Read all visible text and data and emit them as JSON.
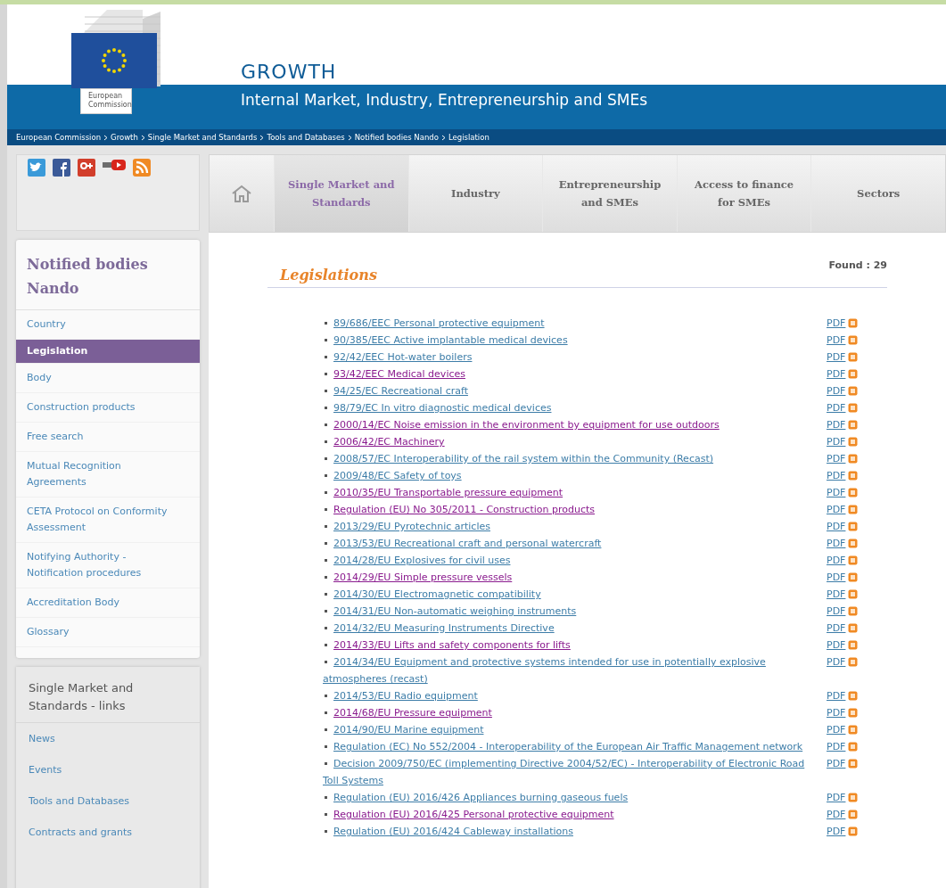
{
  "header": {
    "logo_caption": "European Commission",
    "site_title": "GROWTH",
    "subtitle": "Internal Market, Industry, Entrepreneurship and SMEs"
  },
  "breadcrumb": [
    "European Commission",
    "Growth",
    "Single Market and Standards",
    "Tools and Databases",
    "Notified bodies Nando",
    "Legislation"
  ],
  "social": [
    {
      "kind": "twitter"
    },
    {
      "kind": "facebook"
    },
    {
      "kind": "googleplus"
    },
    {
      "kind": "youtube"
    },
    {
      "kind": "rss"
    }
  ],
  "top_nav": [
    {
      "label": "Single Market and Standards",
      "selected": true
    },
    {
      "label": "Industry",
      "selected": false
    },
    {
      "label": "Entrepreneurship and SMEs",
      "selected": false
    },
    {
      "label": "Access to finance for SMEs",
      "selected": false
    },
    {
      "label": "Sectors",
      "selected": false
    }
  ],
  "sidebar": {
    "title": "Notified bodies Nando",
    "items": [
      {
        "label": "Country",
        "selected": false
      },
      {
        "label": "Legislation",
        "selected": true
      },
      {
        "label": "Body",
        "selected": false
      },
      {
        "label": "Construction products",
        "selected": false
      },
      {
        "label": "Free search",
        "selected": false
      },
      {
        "label": "Mutual Recognition Agreements",
        "selected": false
      },
      {
        "label": "CETA Protocol on Conformity Assessment",
        "selected": false
      },
      {
        "label": "Notifying Authority - Notification procedures",
        "selected": false
      },
      {
        "label": "Accreditation Body",
        "selected": false
      },
      {
        "label": "Glossary",
        "selected": false
      }
    ]
  },
  "links_box": {
    "title": "Single Market and Standards - links",
    "items": [
      "News",
      "Events",
      "Tools and Databases",
      "Contracts and grants"
    ]
  },
  "content": {
    "title": "Legislations",
    "found": "Found : 29",
    "items": [
      {
        "text": "89/686/EEC Personal protective equipment",
        "visited": false,
        "pdf": "PDF"
      },
      {
        "text": "90/385/EEC Active implantable medical devices",
        "visited": false,
        "pdf": "PDF"
      },
      {
        "text": "92/42/EEC Hot-water boilers",
        "visited": false,
        "pdf": "PDF"
      },
      {
        "text": "93/42/EEC Medical devices",
        "visited": true,
        "pdf": "PDF"
      },
      {
        "text": "94/25/EC Recreational craft",
        "visited": false,
        "pdf": "PDF"
      },
      {
        "text": "98/79/EC In vitro diagnostic medical devices",
        "visited": false,
        "pdf": "PDF"
      },
      {
        "text": "2000/14/EC Noise emission in the environment by equipment for use outdoors",
        "visited": true,
        "pdf": "PDF"
      },
      {
        "text": "2006/42/EC Machinery",
        "visited": true,
        "pdf": "PDF"
      },
      {
        "text": "2008/57/EC Interoperability of the rail system within the Community (Recast)",
        "visited": false,
        "pdf": "PDF"
      },
      {
        "text": "2009/48/EC Safety of toys",
        "visited": false,
        "pdf": "PDF"
      },
      {
        "text": "2010/35/EU Transportable pressure equipment",
        "visited": true,
        "pdf": "PDF"
      },
      {
        "text": "Regulation (EU) No 305/2011 - Construction products",
        "visited": true,
        "pdf": "PDF"
      },
      {
        "text": "2013/29/EU Pyrotechnic articles",
        "visited": false,
        "pdf": "PDF"
      },
      {
        "text": "2013/53/EU Recreational craft and personal watercraft",
        "visited": false,
        "pdf": "PDF"
      },
      {
        "text": "2014/28/EU Explosives for civil uses",
        "visited": false,
        "pdf": "PDF"
      },
      {
        "text": "2014/29/EU Simple pressure vessels",
        "visited": true,
        "pdf": "PDF"
      },
      {
        "text": "2014/30/EU Electromagnetic compatibility",
        "visited": false,
        "pdf": "PDF"
      },
      {
        "text": "2014/31/EU Non-automatic weighing instruments",
        "visited": false,
        "pdf": "PDF"
      },
      {
        "text": "2014/32/EU Measuring Instruments Directive",
        "visited": false,
        "pdf": "PDF"
      },
      {
        "text": "2014/33/EU Lifts and safety components for lifts",
        "visited": true,
        "pdf": "PDF"
      },
      {
        "text": "2014/34/EU Equipment and protective systems intended for use in potentially explosive atmospheres (recast)",
        "visited": false,
        "pdf": "PDF"
      },
      {
        "text": "2014/53/EU Radio equipment",
        "visited": false,
        "pdf": "PDF"
      },
      {
        "text": "2014/68/EU Pressure equipment",
        "visited": true,
        "pdf": "PDF"
      },
      {
        "text": "2014/90/EU Marine equipment",
        "visited": false,
        "pdf": "PDF"
      },
      {
        "text": "Regulation (EC) No 552/2004 - Interoperability of the European Air Traffic Management network",
        "visited": false,
        "pdf": "PDF"
      },
      {
        "text": "Decision 2009/750/EC (implementing Directive 2004/52/EC) - Interoperability of Electronic Road Toll Systems",
        "visited": false,
        "pdf": "PDF"
      },
      {
        "text": "Regulation (EU) 2016/426 Appliances burning gaseous fuels",
        "visited": false,
        "pdf": "PDF"
      },
      {
        "text": "Regulation (EU) 2016/425 Personal protective equipment",
        "visited": true,
        "pdf": "PDF"
      },
      {
        "text": "Regulation (EU) 2016/424 Cableway installations",
        "visited": false,
        "pdf": "PDF"
      }
    ]
  }
}
